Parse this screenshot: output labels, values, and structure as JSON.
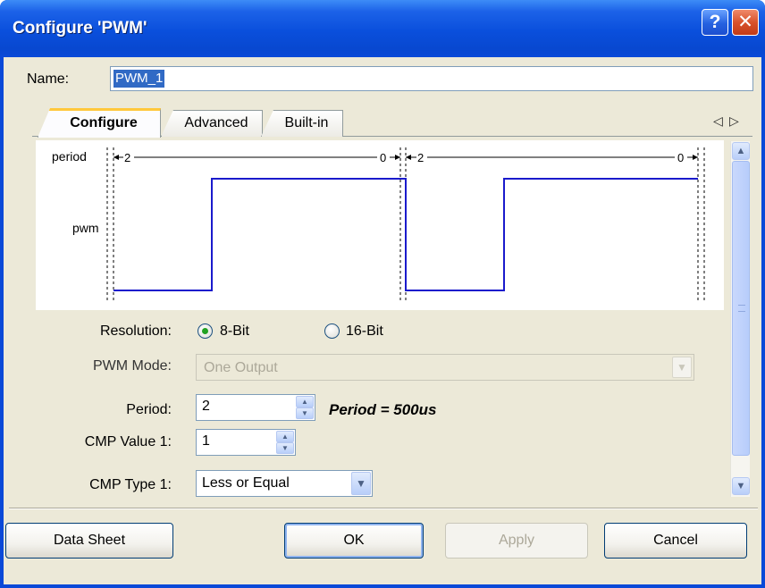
{
  "window": {
    "title": "Configure 'PWM'",
    "help_glyph": "?",
    "close_glyph": "✕"
  },
  "name_field": {
    "label": "Name:",
    "value": "PWM_1"
  },
  "tabs": [
    {
      "label": "Configure",
      "active": true
    },
    {
      "label": "Advanced",
      "active": false
    },
    {
      "label": "Built-in",
      "active": false
    }
  ],
  "tab_scroll": {
    "left": "◁",
    "right": "▷"
  },
  "waveform": {
    "period_label": "period",
    "pwm_label": "pwm",
    "cycle1_start": "2",
    "cycle1_end": "0",
    "cycle2_start": "2",
    "cycle2_end": "0",
    "line_color": "#1a1acc"
  },
  "resolution": {
    "label": "Resolution:",
    "options": [
      {
        "label": "8-Bit",
        "selected": true
      },
      {
        "label": "16-Bit",
        "selected": false
      }
    ]
  },
  "pwm_mode": {
    "label": "PWM Mode:",
    "value": "One Output",
    "enabled": false
  },
  "period": {
    "label": "Period:",
    "value": "2",
    "note": "Period = 500us"
  },
  "cmp_value_1": {
    "label": "CMP Value 1:",
    "value": "1"
  },
  "cmp_type_1": {
    "label": "CMP Type 1:",
    "value": "Less or Equal"
  },
  "buttons": {
    "data_sheet": "Data Sheet",
    "ok": "OK",
    "apply": "Apply",
    "cancel": "Cancel"
  },
  "colors": {
    "title_bar": "#0a4fdc",
    "dialog_face": "#ece9d8",
    "selection": "#316ac5"
  }
}
